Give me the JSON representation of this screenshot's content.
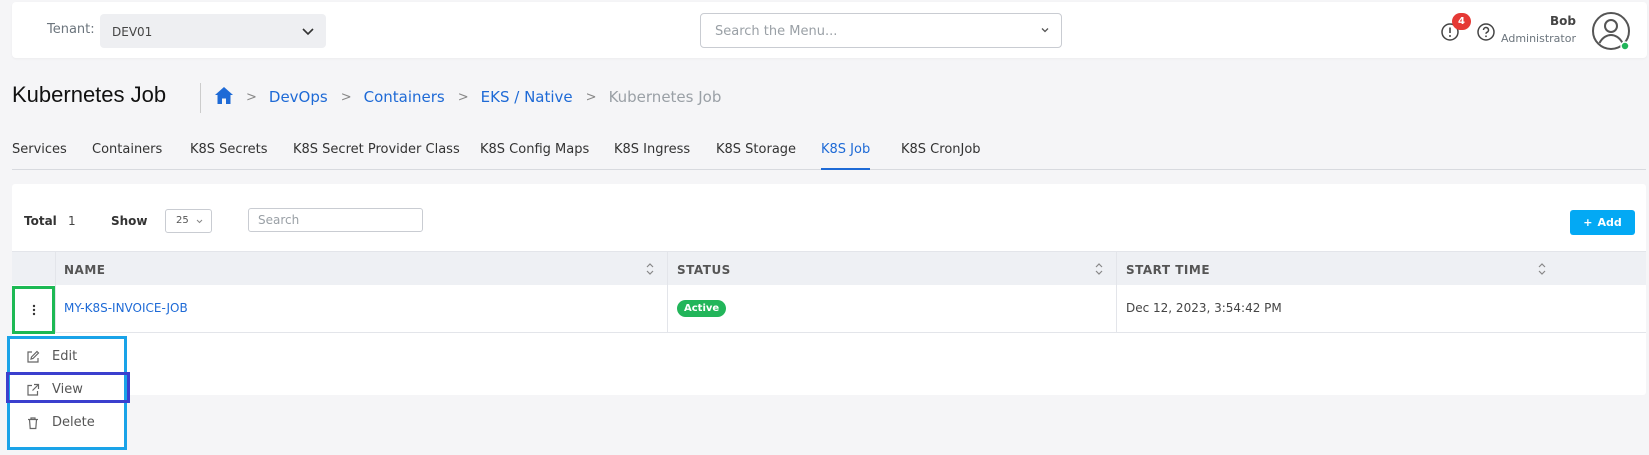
{
  "topbar": {
    "tenant_label": "Tenant:",
    "tenant_value": "DEV01",
    "menu_search_placeholder": "Search the Menu...",
    "notification_count": "4",
    "user_name": "Bob",
    "user_role": "Administrator"
  },
  "page": {
    "title": "Kubernetes Job"
  },
  "breadcrumb": {
    "items": [
      "DevOps",
      "Containers",
      "EKS / Native"
    ],
    "current": "Kubernetes Job"
  },
  "tabs": [
    "Services",
    "Containers",
    "K8S Secrets",
    "K8S Secret Provider Class",
    "K8S Config Maps",
    "K8S Ingress",
    "K8S Storage",
    "K8S Job",
    "K8S CronJob"
  ],
  "active_tab": "K8S Job",
  "toolbar": {
    "total_label": "Total",
    "total_value": "1",
    "show_label": "Show",
    "show_value": "25",
    "search_placeholder": "Search",
    "add_label": "Add"
  },
  "table": {
    "columns": [
      "NAME",
      "STATUS",
      "START TIME"
    ],
    "rows": [
      {
        "name": "MY-K8S-INVOICE-JOB",
        "status": "Active",
        "start_time": "Dec 12, 2023, 3:54:42 PM"
      }
    ]
  },
  "context_menu": {
    "items": [
      "Edit",
      "View",
      "Delete"
    ]
  },
  "colors": {
    "accent": "#1e6ad6",
    "add_button": "#03a9f4",
    "status_active": "#22b55a",
    "badge": "#e53935",
    "action_highlight": "#1db954",
    "menu_highlight": "#1aa3e8",
    "selected_highlight": "#3b3fce"
  },
  "icons": {
    "chevron": "chevron-down-icon",
    "alert": "alert-icon",
    "help": "help-icon",
    "home": "home-icon",
    "kebab": "kebab-icon",
    "edit": "edit-icon",
    "view": "external-link-icon",
    "delete": "trash-icon"
  }
}
